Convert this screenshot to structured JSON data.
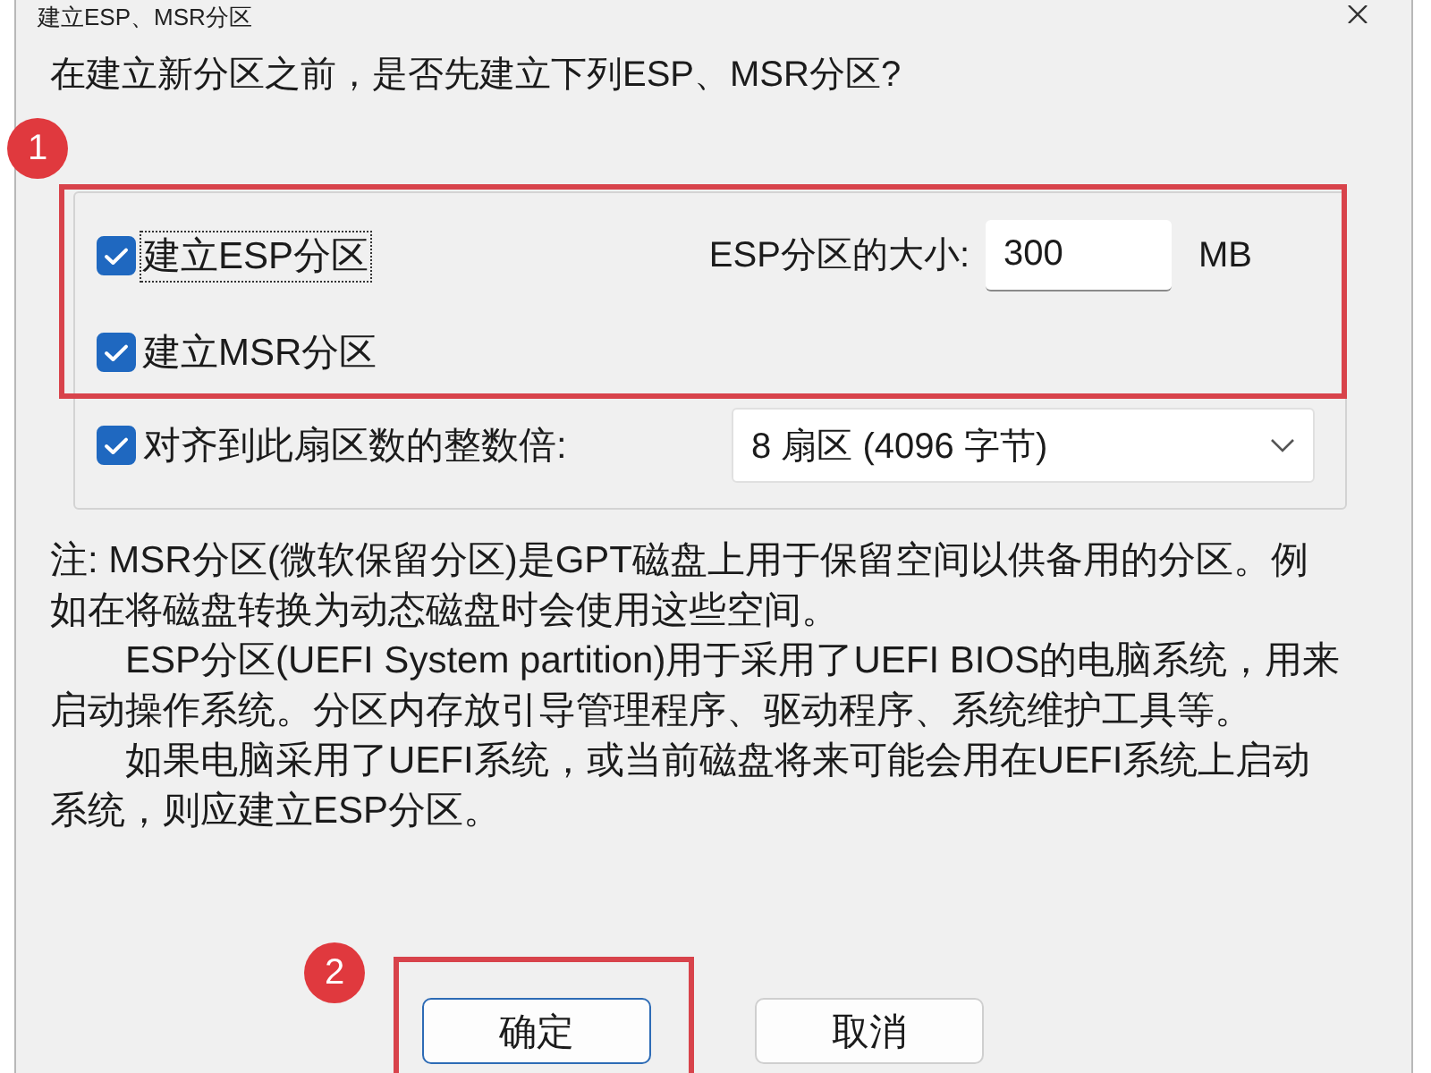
{
  "window": {
    "title": "建立ESP、MSR分区"
  },
  "prompt": "在建立新分区之前，是否先建立下列ESP、MSR分区?",
  "partitions": [
    {
      "label": "建立ESP分区",
      "checked": true,
      "focused": true
    },
    {
      "label": "建立MSR分区",
      "checked": true,
      "focused": false
    }
  ],
  "esp_size": {
    "label": "ESP分区的大小:",
    "value": "300",
    "unit": "MB"
  },
  "alignment": {
    "label": "对齐到此扇区数的整数倍:",
    "checked": true,
    "value": "8 扇区 (4096 字节)"
  },
  "notes": [
    "注: MSR分区(微软保留分区)是GPT磁盘上用于保留空间以供备用的分区。例如在将磁盘转换为动态磁盘时会使用这些空间。",
    "ESP分区(UEFI System partition)用于采用了UEFI BIOS的电脑系统，用来启动操作系统。分区内存放引导管理程序、驱动程序、系统维护工具等。",
    "如果电脑采用了UEFI系统，或当前磁盘将来可能会用在UEFI系统上启动系统，则应建立ESP分区。"
  ],
  "buttons": [
    {
      "label": "确定",
      "default": true
    },
    {
      "label": "取消",
      "default": false
    }
  ],
  "annotations": [
    {
      "number": "1"
    },
    {
      "number": "2"
    }
  ]
}
